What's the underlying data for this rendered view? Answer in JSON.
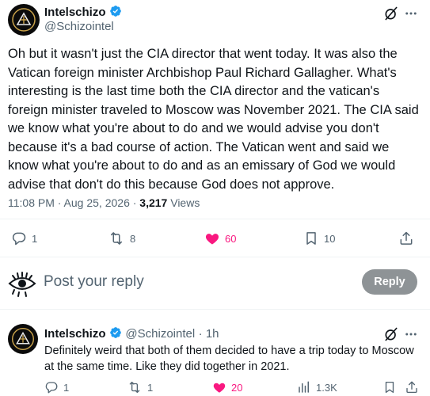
{
  "main_tweet": {
    "author_name": "Intelschizo",
    "author_handle": "@Schizointel",
    "text": "Oh but it wasn't just the CIA director that went today. It was also the Vatican foreign minister Archbishop Paul Richard Gallagher. What's interesting is the last time both the CIA director and the vatican's foreign minister traveled to Moscow was November 2021. The CIA said we know what you're about to do and we would advise you don't because it's a bad course of action. The Vatican went and said we know what you're about to do and as an emissary of God we would advise that don't do this because God does not approve.",
    "timestamp": "11:08 PM · Aug 25, 2026 · ",
    "views_count": "3,217",
    "views_label": " Views",
    "replies": "1",
    "reposts": "8",
    "likes": "60",
    "bookmarks": "10"
  },
  "composer": {
    "placeholder": "Post your reply",
    "reply_button": "Reply"
  },
  "reply_tweet": {
    "author_name": "Intelschizo",
    "author_handle": "@Schizointel",
    "time": "· 1h",
    "text": "Definitely weird that both of them decided to have a trip today to Moscow at the same time. Like they did together in 2021.",
    "replies": "1",
    "reposts": "1",
    "likes": "20",
    "views": "1.3K"
  },
  "colors": {
    "verified": "#1d9bf0",
    "like": "#f91880",
    "muted": "#536471",
    "reply_button": "#8e9396"
  },
  "icons": [
    "verified-badge-icon",
    "grok-icon",
    "more-icon",
    "reply-icon",
    "repost-icon",
    "heart-icon",
    "bookmark-icon",
    "share-icon",
    "views-icon"
  ]
}
